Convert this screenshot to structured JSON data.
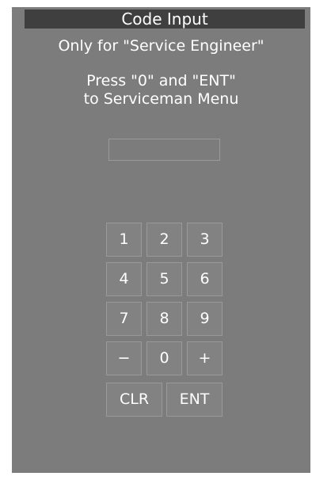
{
  "dialog": {
    "title": "Code Input",
    "subtitle": "Only for \"Service Engineer\"",
    "instruction_line1": "Press \"0\" and \"ENT\"",
    "instruction_line2": "to Serviceman Menu"
  },
  "code_input": {
    "value": ""
  },
  "keypad": {
    "k1": "1",
    "k2": "2",
    "k3": "3",
    "k4": "4",
    "k5": "5",
    "k6": "6",
    "k7": "7",
    "k8": "8",
    "k9": "9",
    "minus": "−",
    "k0": "0",
    "plus": "+",
    "clear": "CLR",
    "enter": "ENT"
  }
}
